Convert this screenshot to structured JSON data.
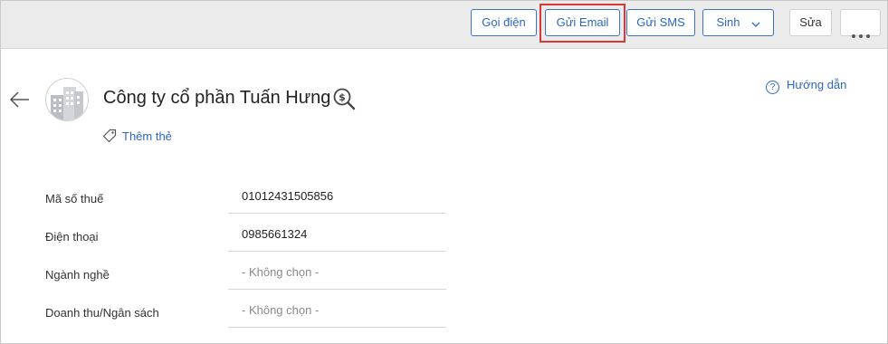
{
  "toolbar": {
    "call_label": "Gọi điện",
    "email_label": "Gửi Email",
    "sms_label": "Gửi SMS",
    "generate_label": "Sinh",
    "edit_label": "Sửa"
  },
  "header": {
    "company_name": "Công ty cổ phần Tuấn Hưng",
    "help_label": "Hướng dẫn",
    "add_tag_label": "Thêm thẻ"
  },
  "fields": [
    {
      "label": "Mã số thuế",
      "value": "01012431505856"
    },
    {
      "label": "Điện thoại",
      "value": "0985661324"
    },
    {
      "label": "Ngành nghề",
      "value": "- Không chọn -"
    },
    {
      "label": "Doanh thu/Ngân sách",
      "value": "- Không chọn -"
    }
  ],
  "colors": {
    "accent": "#2e67bd",
    "highlight": "#d9393a"
  }
}
